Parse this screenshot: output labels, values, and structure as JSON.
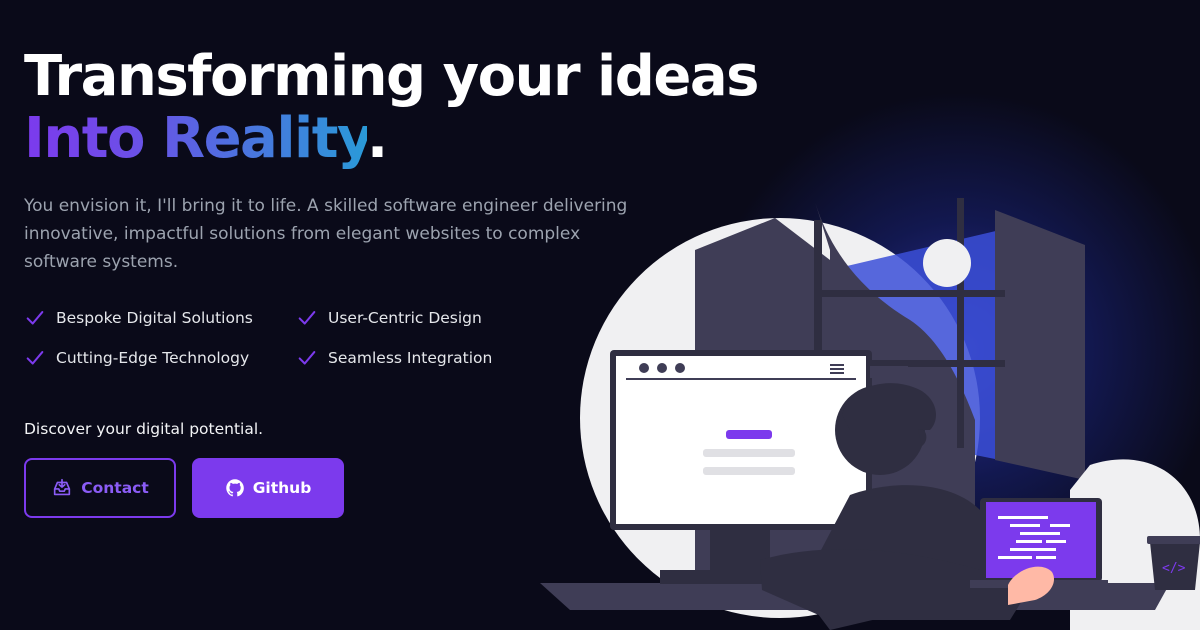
{
  "hero": {
    "headline_line1": "Transforming your ideas",
    "headline_highlight": "Into Reality",
    "headline_period": ".",
    "description": "You envision it, I'll bring it to life. A skilled software engineer delivering innovative, impactful solutions from elegant websites to complex software systems.",
    "features": [
      {
        "label": "Bespoke Digital Solutions",
        "icon": "check-icon"
      },
      {
        "label": "User-Centric Design",
        "icon": "check-icon"
      },
      {
        "label": "Cutting-Edge Technology",
        "icon": "check-icon"
      },
      {
        "label": "Seamless Integration",
        "icon": "check-icon"
      }
    ],
    "cta_text": "Discover your digital potential."
  },
  "buttons": {
    "contact_label": "Contact",
    "contact_icon": "inbox-icon",
    "github_label": "Github",
    "github_icon": "github-icon"
  },
  "colors": {
    "background": "#0a0a19",
    "accent": "#7c3aed",
    "gradient_start": "#7c3aed",
    "gradient_end": "#2a9ad8",
    "text_muted": "#9ca3af"
  }
}
